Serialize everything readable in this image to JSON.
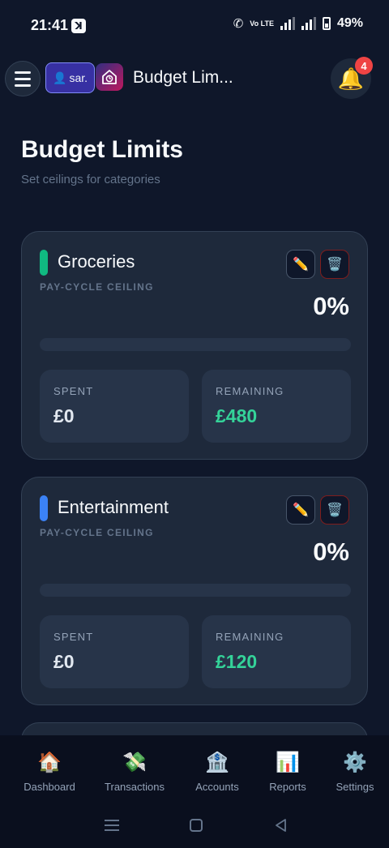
{
  "status_bar": {
    "time": "21:41",
    "battery": "49%",
    "volte": "Vo LTE"
  },
  "header": {
    "user_chip": "sar.",
    "title": "Budget Lim...",
    "notification_count": "4"
  },
  "page": {
    "title": "Budget Limits",
    "subtitle": "Set ceilings for categories"
  },
  "budgets": [
    {
      "name": "Groceries",
      "caption": "PAY-CYCLE CEILING",
      "percent_label": "0%",
      "progress": 0,
      "accent": "#10b981",
      "spent_label": "SPENT",
      "spent": "£0",
      "remaining_label": "REMAINING",
      "remaining": "£480"
    },
    {
      "name": "Entertainment",
      "caption": "PAY-CYCLE CEILING",
      "percent_label": "0%",
      "progress": 0,
      "accent": "#3b82f6",
      "spent_label": "SPENT",
      "spent": "£0",
      "remaining_label": "REMAINING",
      "remaining": "£120"
    }
  ],
  "card_icons": {
    "edit": "pencil-icon",
    "delete": "trash-icon"
  },
  "bottom_nav": [
    {
      "label": "Dashboard",
      "icon": "house-icon",
      "glyph": "🏠"
    },
    {
      "label": "Transactions",
      "icon": "money-icon",
      "glyph": "💸"
    },
    {
      "label": "Accounts",
      "icon": "bank-icon",
      "glyph": "🏦"
    },
    {
      "label": "Reports",
      "icon": "chart-icon",
      "glyph": "📊"
    },
    {
      "label": "Settings",
      "icon": "gear-icon",
      "glyph": "⚙️"
    }
  ],
  "colors": {
    "background": "#0f172a",
    "card": "#1e293b",
    "remaining_value": "#34d399",
    "badge": "#ef4444"
  }
}
